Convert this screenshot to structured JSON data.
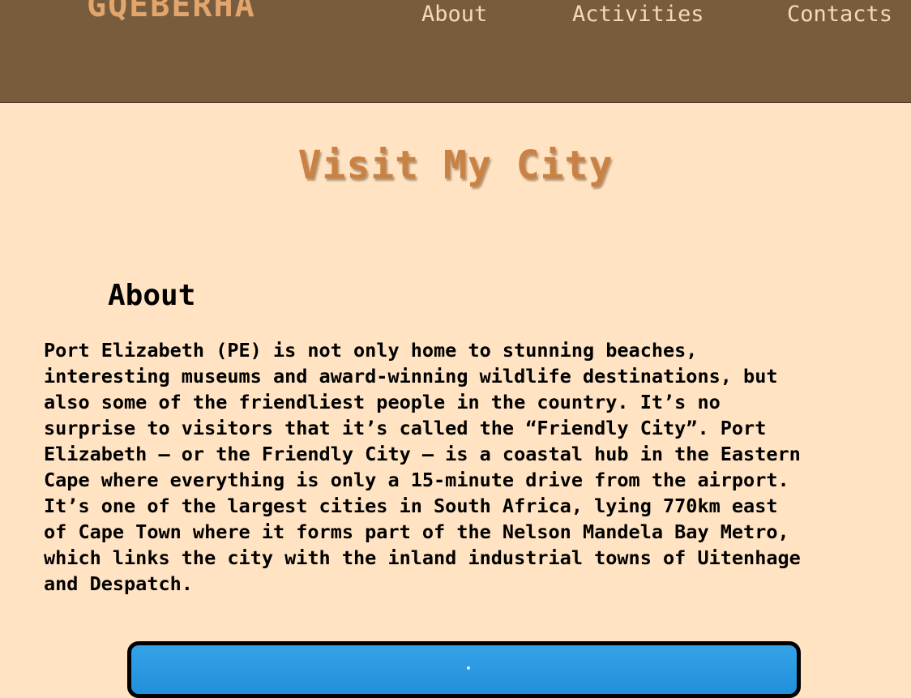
{
  "header": {
    "logo_text": "GQEBERHA",
    "nav": [
      {
        "label": "About"
      },
      {
        "label": "Activities"
      },
      {
        "label": "Contacts"
      }
    ]
  },
  "hero": {
    "title": "Visit My City"
  },
  "about": {
    "heading": "About",
    "body": "Port Elizabeth (PE) is not only home to stunning beaches, interesting museums and award-winning wildlife destinations, but also some of the friendliest people in the country. It’s no surprise to visitors that it’s called the “Friendly City”. Port Elizabeth – or the Friendly City – is a coastal hub in the Eastern Cape where everything is only a 15-minute drive from the airport. It’s one of the largest cities in South Africa, lying 770km east of Cape Town where it forms part of the Nelson Mandela Bay Metro, which links the city with the inland industrial towns of Uitenhage and Despatch."
  },
  "colors": {
    "header_bg": "#775c3e",
    "page_bg": "#ffe3c2",
    "logo": "#e2a56c",
    "nav_text": "#f6d9b5",
    "title": "#c98244"
  }
}
